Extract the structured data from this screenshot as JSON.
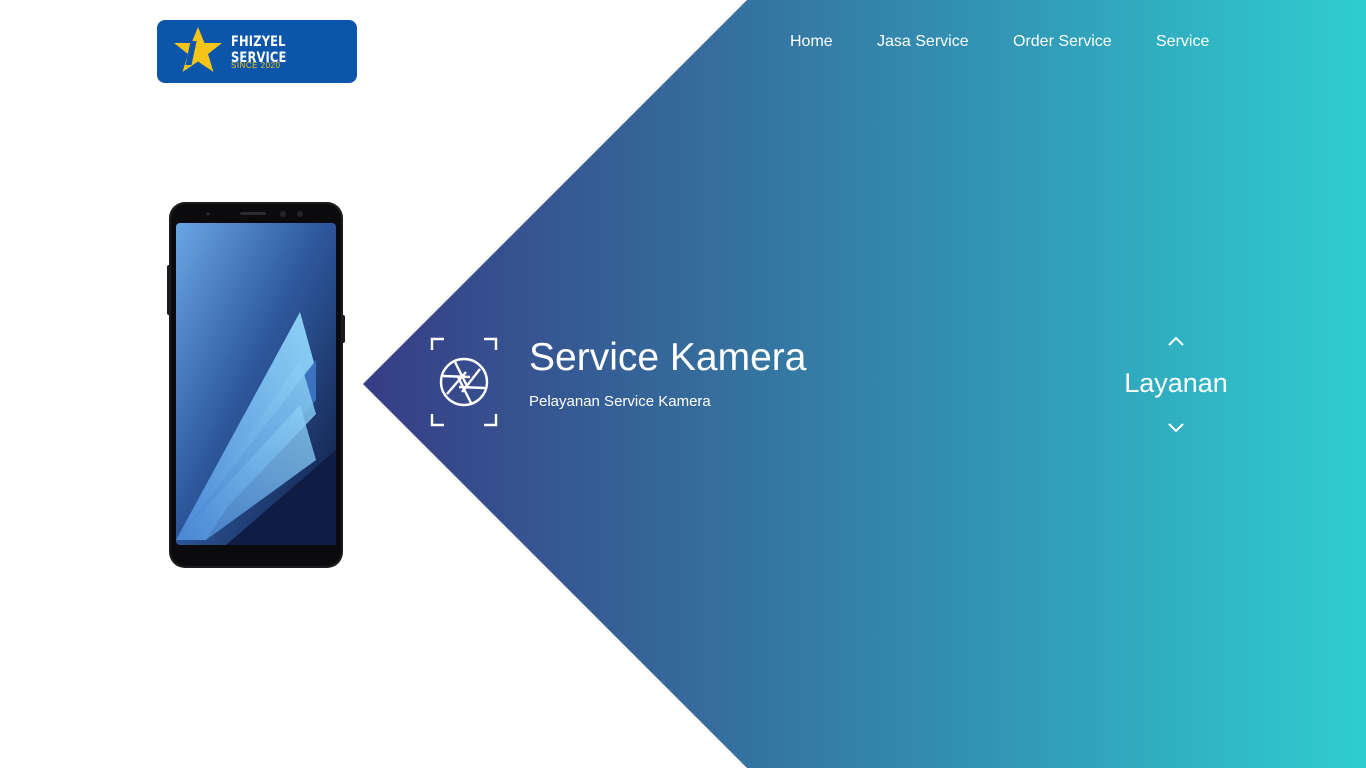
{
  "brand": {
    "name": "FHIZYEL SERVICE",
    "since": "SINCE 2020",
    "logo_color": "#0b55aa",
    "star_color": "#f5c518"
  },
  "nav": {
    "items": [
      {
        "label": "Home"
      },
      {
        "label": "Jasa Service"
      },
      {
        "label": "Order Service"
      },
      {
        "label": "Service"
      }
    ]
  },
  "hero": {
    "icon": "camera-aperture-icon",
    "title": "Service Kamera",
    "subtitle": "Pelayanan Service Kamera",
    "gradient_start": "#363d85",
    "gradient_end": "#2fcdcf"
  },
  "slider": {
    "label": "Layanan",
    "up_icon": "chevron-up-icon",
    "down_icon": "chevron-down-icon"
  }
}
